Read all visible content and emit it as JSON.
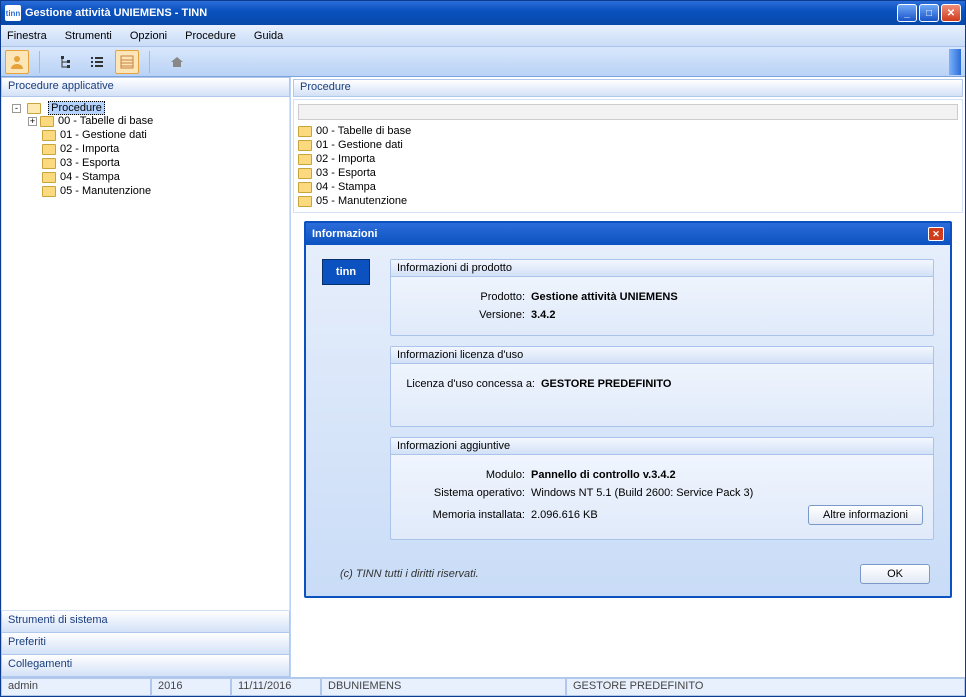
{
  "title": "Gestione attività UNIEMENS - TINN",
  "menu": {
    "finestra": "Finestra",
    "strumenti": "Strumenti",
    "opzioni": "Opzioni",
    "procedure": "Procedure",
    "guida": "Guida"
  },
  "left": {
    "header": "Procedure applicative",
    "root": "Procedure",
    "items": [
      {
        "label": "00 - Tabelle di base",
        "expandable": true
      },
      {
        "label": "01 - Gestione dati"
      },
      {
        "label": "02 - Importa"
      },
      {
        "label": "03 - Esporta"
      },
      {
        "label": "04 - Stampa"
      },
      {
        "label": "05 - Manutenzione"
      }
    ],
    "stack": {
      "sistema": "Strumenti di sistema",
      "preferiti": "Preferiti",
      "collegamenti": "Collegamenti"
    }
  },
  "right": {
    "header": "Procedure",
    "items": [
      "00 - Tabelle di base",
      "01 - Gestione dati",
      "02 - Importa",
      "03 - Esporta",
      "04 - Stampa",
      "05 - Manutenzione"
    ]
  },
  "dialog": {
    "title": "Informazioni",
    "tinn": "tinn",
    "g1": "Informazioni di prodotto",
    "prodotto_l": "Prodotto:",
    "prodotto_v": "Gestione attività UNIEMENS",
    "versione_l": "Versione:",
    "versione_v": "3.4.2",
    "g2": "Informazioni licenza d'uso",
    "licenza_l": "Licenza d'uso concessa a:",
    "licenza_v": "GESTORE PREDEFINITO",
    "g3": "Informazioni aggiuntive",
    "modulo_l": "Modulo:",
    "modulo_v": "Pannello di controllo v.3.4.2",
    "so_l": "Sistema operativo:",
    "so_v": "Windows NT 5.1 (Build 2600: Service Pack 3)",
    "mem_l": "Memoria installata:",
    "mem_v": "2.096.616 KB",
    "altre": "Altre informazioni",
    "copy": "(c) TINN tutti i diritti riservati.",
    "ok": "OK"
  },
  "status": {
    "user": "admin",
    "year": "2016",
    "date": "11/11/2016",
    "db": "DBUNIEMENS",
    "gestore": "GESTORE PREDEFINITO"
  }
}
